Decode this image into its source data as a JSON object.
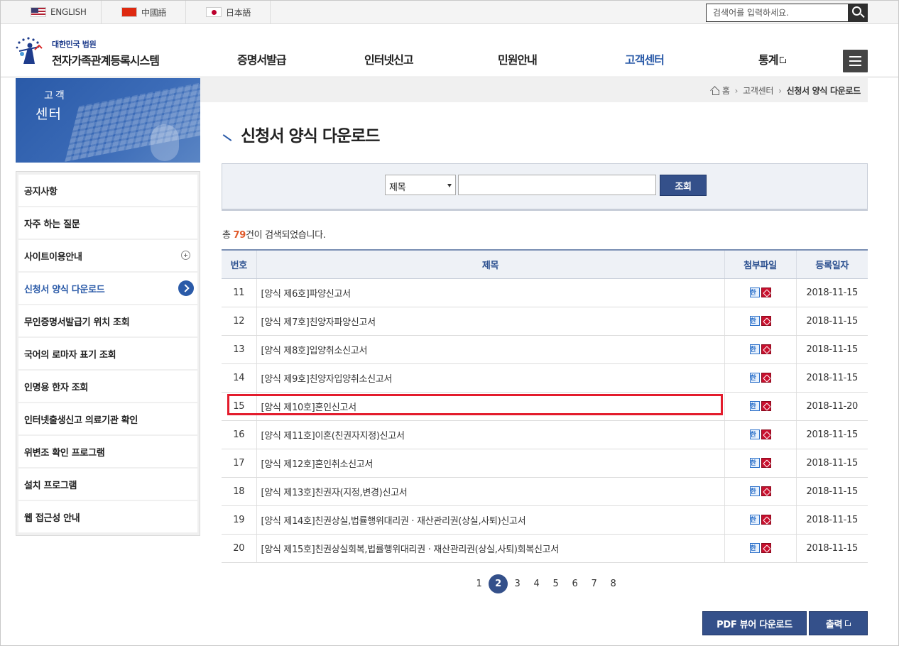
{
  "topbar": {
    "languages": [
      {
        "label": "ENGLISH",
        "flag": "us-flag-icon"
      },
      {
        "label": "中國語",
        "flag": "cn-flag-icon"
      },
      {
        "label": "日本語",
        "flag": "jp-flag-icon"
      }
    ],
    "search_placeholder": "검색어를 입력하세요."
  },
  "header": {
    "logo_sub": "대한민국 법원",
    "logo_title": "전자가족관계등록시스템",
    "nav": [
      {
        "label": "증명서발급"
      },
      {
        "label": "인터넷신고"
      },
      {
        "label": "민원안내"
      },
      {
        "label": "고객센터"
      },
      {
        "label": "통계"
      }
    ]
  },
  "sidebar": {
    "banner_line1": "고객",
    "banner_line2": "센터",
    "items": [
      {
        "label": "공지사항"
      },
      {
        "label": "자주 하는 질문"
      },
      {
        "label": "사이트이용안내"
      },
      {
        "label": "신청서 양식 다운로드"
      },
      {
        "label": "무인증명서발급기 위치 조회"
      },
      {
        "label": "국어의 로마자 표기 조회"
      },
      {
        "label": "인명용 한자 조회"
      },
      {
        "label": "인터넷출생신고 의료기관 확인"
      },
      {
        "label": "위변조 확인 프로그램"
      },
      {
        "label": "설치 프로그램"
      },
      {
        "label": "웹 접근성 안내"
      }
    ]
  },
  "breadcrumb": {
    "home": "홈",
    "level1": "고객센터",
    "current": "신청서 양식 다운로드"
  },
  "page": {
    "title": "신청서 양식 다운로드"
  },
  "search": {
    "select_value": "제목",
    "button": "조회"
  },
  "result": {
    "prefix": "총 ",
    "count": "79",
    "suffix": "건이 검색되었습니다."
  },
  "table": {
    "headers": {
      "no": "번호",
      "title": "제목",
      "file": "첨부파일",
      "date": "등록일자"
    },
    "rows": [
      {
        "no": "11",
        "title": "[양식 제6호]파양신고서",
        "date": "2018-11-15"
      },
      {
        "no": "12",
        "title": "[양식 제7호]친양자파양신고서",
        "date": "2018-11-15"
      },
      {
        "no": "13",
        "title": "[양식 제8호]입양취소신고서",
        "date": "2018-11-15"
      },
      {
        "no": "14",
        "title": "[양식 제9호]친양자입양취소신고서",
        "date": "2018-11-15"
      },
      {
        "no": "15",
        "title": "[양식 제10호]혼인신고서",
        "date": "2018-11-20"
      },
      {
        "no": "16",
        "title": "[양식 제11호]이혼(친권자지정)신고서",
        "date": "2018-11-15"
      },
      {
        "no": "17",
        "title": "[양식 제12호]혼인취소신고서",
        "date": "2018-11-15"
      },
      {
        "no": "18",
        "title": "[양식 제13호]친권자(지정,변경)신고서",
        "date": "2018-11-15"
      },
      {
        "no": "19",
        "title": "[양식 제14호]친권상실,법률행위대리권 · 재산관리권(상실,사퇴)신고서",
        "date": "2018-11-15"
      },
      {
        "no": "20",
        "title": "[양식 제15호]친권상실회복,법률행위대리권 · 재산관리권(상실,사퇴)회복신고서",
        "date": "2018-11-15"
      }
    ]
  },
  "pagination": {
    "pages": [
      "1",
      "2",
      "3",
      "4",
      "5",
      "6",
      "7",
      "8"
    ],
    "current": "2"
  },
  "buttons": {
    "pdf_viewer": "PDF 뷰어 다운로드",
    "print": "출력"
  },
  "colors": {
    "accent": "#34508a",
    "highlight": "#e31b2c",
    "count": "#e05a2b"
  }
}
